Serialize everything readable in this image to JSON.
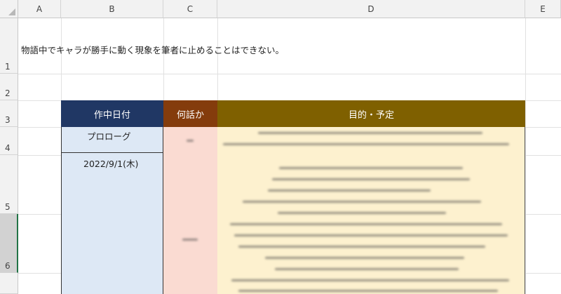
{
  "spreadsheet": {
    "columns": [
      "A",
      "B",
      "C",
      "D",
      "E"
    ],
    "rows": [
      "1",
      "2",
      "3",
      "4",
      "5",
      "6"
    ],
    "intro_text": "物語中でキャラが勝手に動く現象を筆者に止めることはできない。",
    "table": {
      "headers": {
        "date": "作中日付",
        "episode": "何話か",
        "goal": "目的・予定"
      },
      "rows": [
        {
          "date": "プロローグ"
        },
        {
          "date": "2022/9/1(木)"
        }
      ]
    }
  },
  "colors": {
    "header_date": "#203764",
    "header_episode": "#843c0c",
    "header_goal": "#7f6000",
    "fill_date": "#dde8f5",
    "fill_episode": "#fadbd2",
    "fill_goal": "#fdf1cf"
  }
}
